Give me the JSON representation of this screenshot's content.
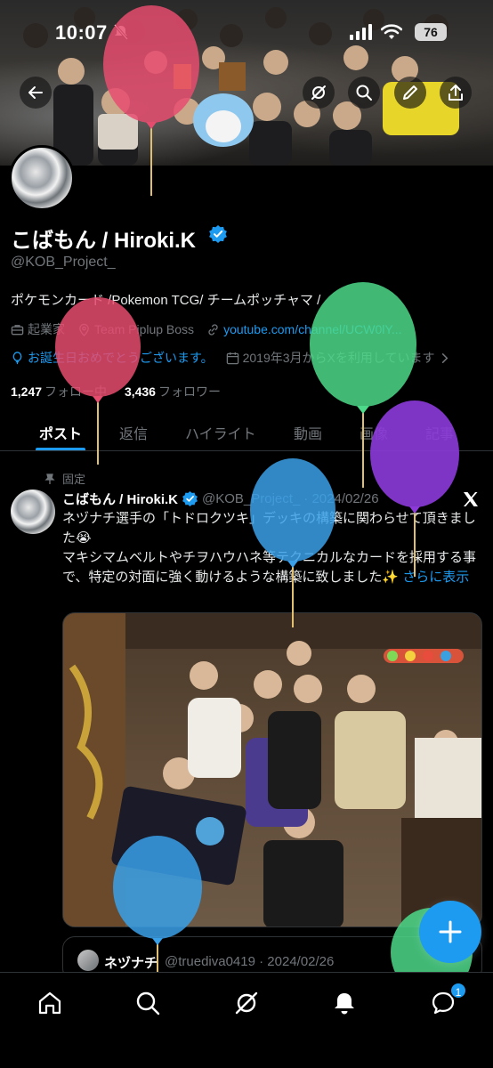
{
  "status_bar": {
    "time": "10:07",
    "battery": "76"
  },
  "profile": {
    "display_name": "こばもん / Hiroki.K",
    "handle": "@KOB_Project_",
    "bio": "ポケモンカード /Pokemon TCG/ チームポッチャマ /",
    "job": "起業家",
    "location": "Team Piplup Boss",
    "website": "youtube.com/channel/UCW0lY...",
    "birthday": "お誕生日おめでとうございます。",
    "joined": "2019年3月からXを利用しています",
    "following_count": "1,247",
    "following_label": "フォロー中",
    "followers_count": "3,436",
    "followers_label": "フォロワー"
  },
  "tabs": [
    "ポスト",
    "返信",
    "ハイライト",
    "動画",
    "画像",
    "記事"
  ],
  "post": {
    "pinned_label": "固定",
    "author_name": "こばもん / Hiroki.K",
    "author_handle": "@KOB_Project_",
    "date": "· 2024/02/26",
    "text_line1": "ネヅナチ選手の「トドロクツキ」デッキの構築に関わらせて頂きました😭",
    "text_line2": "マキシマムベルトやチヲハウハネ等テクニカルなカードを採用する事で、特定の対面に強く動けるような構築に致しました✨",
    "more": "さらに表示"
  },
  "quote": {
    "name": "ネヅナチ",
    "handle": "@truediva0419 · 2024/02/26"
  },
  "notifications_badge": "1",
  "icons": [
    "back-icon",
    "grok-icon",
    "search-icon",
    "edit-icon",
    "share-icon",
    "home-icon",
    "explore-icon",
    "grok-nav-icon",
    "bell-icon",
    "messages-icon",
    "plus-icon",
    "x-logo-icon",
    "verified-icon",
    "pin-icon"
  ],
  "colors": {
    "accent": "#1d9bf0",
    "background": "#000000",
    "muted": "#71767b",
    "divider": "#2f3336"
  }
}
